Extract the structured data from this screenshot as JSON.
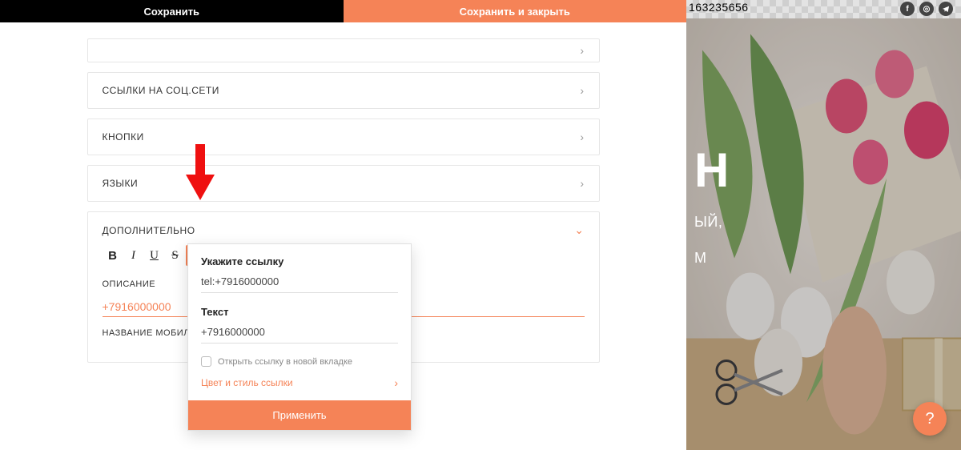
{
  "topbar": {
    "save": "Сохранить",
    "save_close": "Сохранить и закрыть"
  },
  "panels": {
    "social": "ССЫЛКИ НА СОЦ.СЕТИ",
    "buttons": "КНОПКИ",
    "languages": "ЯЗЫКИ",
    "extra": "ДОПОЛНИТЕЛЬНО",
    "description": "ОПИСАНИЕ",
    "mobile_name": "НАЗВАНИЕ МОБИЛ",
    "phone_value": "+7916000000"
  },
  "popover": {
    "url_label": "Укажите ссылку",
    "url_value": "tel:+7916000000",
    "text_label": "Текст",
    "text_value": "+7916000000",
    "newtab_label": "Открыть ссылку в новой вкладке",
    "style_label": "Цвет и стиль ссылки",
    "apply": "Применить"
  },
  "preview": {
    "phone_fragment": "163235656",
    "hero_big": "Н",
    "hero_line1": "ЫЙ,",
    "hero_line2": "М"
  },
  "help": "?"
}
